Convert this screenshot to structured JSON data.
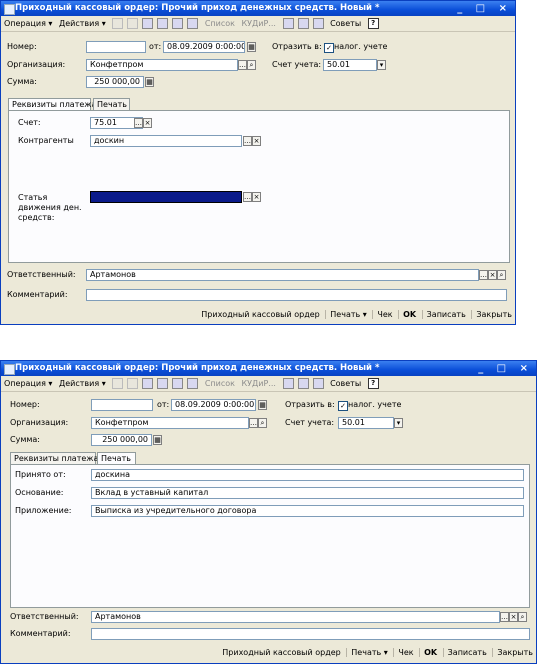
{
  "window": {
    "title": "Приходный кассовый ордер: Прочий приход денежных средств. Новый *",
    "controls": "_ □ ×"
  },
  "menu": {
    "operation": "Операция ▾",
    "actions": "Действия ▾",
    "list": "Список",
    "kud": "КУДиР...",
    "tips": "Советы"
  },
  "form": {
    "number_label": "Номер:",
    "number_value": "",
    "date_label": "от:",
    "date_value": "08.09.2009  0:00:00",
    "org_label": "Организация:",
    "org_value": "Конфетпром",
    "sum_label": "Сумма:",
    "sum_value": "250 000,00",
    "reflect_label": "Отразить в:",
    "tax_label": "налог. учете",
    "account_label": "Счет учета:",
    "account_value": "50.01",
    "responsible_label": "Ответственный:",
    "responsible_value": "Артамонов",
    "comment_label": "Комментарий:",
    "comment_value": ""
  },
  "tabs": {
    "payment": "Реквизиты платежа",
    "print": "Печать"
  },
  "payment_tab": {
    "account_label": "Счет:",
    "account_value": "75.01",
    "counterparty_label": "Контрагенты",
    "counterparty_value": "доскин",
    "article_label": "Статья движения ден. средств:"
  },
  "print_tab": {
    "received_label": "Принято от:",
    "received_value": "доскина",
    "basis_label": "Основание:",
    "basis_value": "Вклад в уставный капитал",
    "attachment_label": "Приложение:",
    "attachment_value": "Выписка из учредительного договора"
  },
  "status": {
    "order": "Приходный кассовый ордер",
    "print": "Печать ▾",
    "check": "Чек",
    "ok": "OK",
    "save": "Записать",
    "close": "Закрыть"
  }
}
